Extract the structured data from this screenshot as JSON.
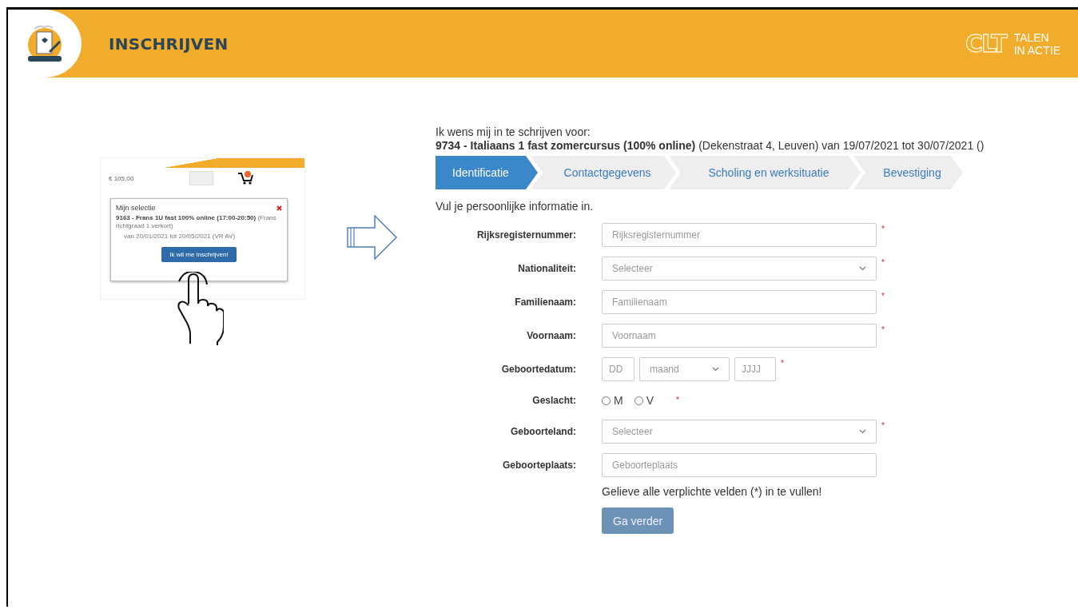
{
  "header": {
    "title": "INSCHRIJVEN",
    "logo_mark": "CLT",
    "logo_text": [
      "TALEN",
      "IN ACTIE"
    ]
  },
  "inset": {
    "price": "€ 105,00",
    "popup_title": "Mijn selectie",
    "item": "**9163 - Frans 1U fast 100% online (17:00-20:50)** (Frans richtgraad 1 verkort)",
    "item_dates": "van 20/01/2021 tot 20/05/2021 (VR AV)",
    "button": "Ik wil me inschrijven!"
  },
  "intro": "Ik wens mij in te schrijven voor:",
  "course": "**9734 - Italiaans 1 fast zomercursus (100% online)** (Dekenstraat 4, Leuven) van 19/07/2021 tot 30/07/2021 ()",
  "steps": [
    {
      "label": "Identificatie",
      "selected": true
    },
    {
      "label": "Contactgegevens",
      "selected": false
    },
    {
      "label": "Scholing en werksituatie",
      "selected": false
    },
    {
      "label": "Bevestiging",
      "selected": false
    }
  ],
  "instruction": "Vul je persoonlijke informatie in.",
  "fields": [
    {
      "kind": "text",
      "label": "Rijksregisternummer:",
      "placeholder": "Rijksregisternummer",
      "required_mark": "*"
    },
    {
      "kind": "select",
      "label": "Nationaliteit:",
      "value": "Selecteer",
      "required_mark": "*"
    },
    {
      "kind": "text",
      "label": "Familienaam:",
      "placeholder": "Familienaam",
      "required_mark": "*"
    },
    {
      "kind": "text",
      "label": "Voornaam:",
      "placeholder": "Voornaam",
      "required_mark": "*"
    },
    {
      "kind": "date",
      "label": "Geboortedatum:",
      "parts": [
        {
          "kind": "text",
          "placeholder": "DD"
        },
        {
          "kind": "select",
          "value": "maand"
        },
        {
          "kind": "text",
          "placeholder": "JJJJ"
        }
      ],
      "required_mark": "*"
    },
    {
      "kind": "radio",
      "label": "Geslacht:",
      "options": [
        {
          "label": "M",
          "selected": false
        },
        {
          "label": "V",
          "selected": false
        }
      ],
      "required_mark": "*"
    },
    {
      "kind": "select",
      "label": "Geboorteland:",
      "value": "Selecteer",
      "required_mark": "*"
    },
    {
      "kind": "text",
      "label": "Geboorteplaats:",
      "placeholder": "Geboorteplaats"
    }
  ],
  "note": "Gelieve alle verplichte velden (*) in te vullen!",
  "submit": "Ga verder"
}
